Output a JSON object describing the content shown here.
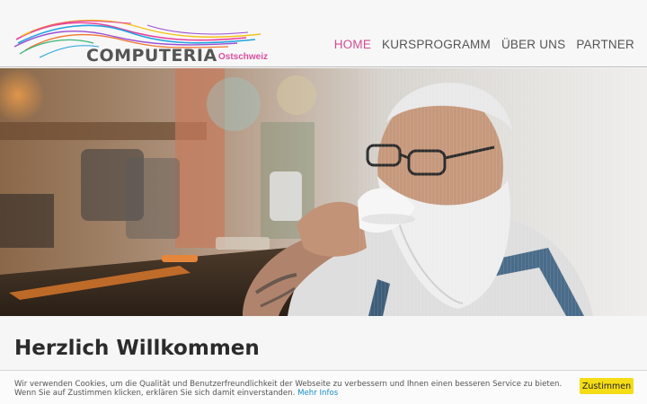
{
  "header": {
    "logo": {
      "name": "COMPUTERIA",
      "sub": "Ostschweiz"
    },
    "nav": [
      {
        "label": "HOME",
        "active": true
      },
      {
        "label": "KURSPROGRAMM",
        "active": false
      },
      {
        "label": "ÜBER UNS",
        "active": false
      },
      {
        "label": "PARTNER",
        "active": false
      }
    ]
  },
  "hero": {
    "image": "senior-man-drinking-espresso-photo"
  },
  "main": {
    "title": "Herzlich Willkommen"
  },
  "cookie": {
    "text": "Wir verwenden Cookies, um die Qualität und Benutzerfreundlichkeit der Webseite zu verbessern und Ihnen einen besseren Service zu bieten. Wenn Sie auf Zustimmen klicken, erklären Sie sich damit einverstanden.",
    "more_label": "Mehr Infos",
    "accept_label": "Zustimmen"
  },
  "colors": {
    "accent": "#d24c93",
    "cookie_button": "#f4dc16",
    "link": "#1a8fc4"
  }
}
